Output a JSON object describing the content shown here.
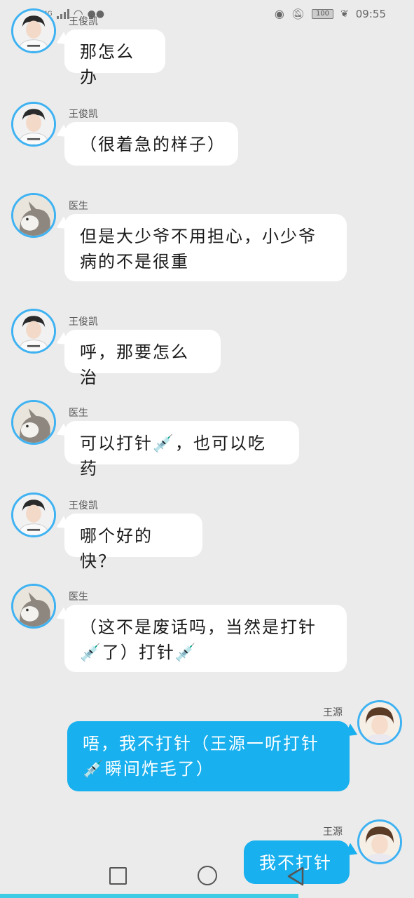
{
  "status_bar": {
    "network": "4G",
    "battery": "100",
    "time": "09:55",
    "icons": [
      "sim-icon",
      "signal-icon",
      "wifi-icon",
      "wechat-icon",
      "eye-icon",
      "mute-bell-icon",
      "battery-icon",
      "leaf-icon"
    ]
  },
  "messages": [
    {
      "sender": "王俊凯",
      "side": "left",
      "avatar": "boy-avatar",
      "lines": [
        "那怎么办"
      ]
    },
    {
      "sender": "王俊凯",
      "side": "left",
      "avatar": "boy-avatar",
      "lines": [
        "（很着急的样子）"
      ]
    },
    {
      "sender": "医生",
      "side": "left",
      "avatar": "cat-avatar",
      "lines": [
        "但是大少爷不用担心，小少爷",
        "病的不是很重"
      ]
    },
    {
      "sender": "王俊凯",
      "side": "left",
      "avatar": "boy-avatar",
      "lines": [
        "呼，那要怎么治"
      ]
    },
    {
      "sender": "医生",
      "side": "left",
      "avatar": "cat-avatar",
      "lines": [
        "可以打针💉，也可以吃药"
      ]
    },
    {
      "sender": "王俊凯",
      "side": "left",
      "avatar": "boy-avatar",
      "lines": [
        "哪个好的快？"
      ]
    },
    {
      "sender": "医生",
      "side": "left",
      "avatar": "cat-avatar",
      "lines": [
        "（这不是废话吗，当然是打针",
        "💉了）打针💉"
      ]
    },
    {
      "sender": "王源",
      "side": "right",
      "avatar": "boy2-avatar",
      "lines": [
        "唔，我不打针（王源一听打针",
        "💉瞬间炸毛了）"
      ]
    },
    {
      "sender": "王源",
      "side": "right",
      "avatar": "boy2-avatar",
      "lines": [
        "我不打针"
      ]
    }
  ],
  "nav": {
    "buttons": [
      "recent-apps-button",
      "home-button",
      "back-button"
    ]
  },
  "scroll_progress": 0.72,
  "colors": {
    "background": "#ebebeb",
    "bubble_left": "#ffffff",
    "bubble_right": "#18b0ee",
    "avatar_ring": "#3fb2f2",
    "progress": "#3ecce4"
  }
}
